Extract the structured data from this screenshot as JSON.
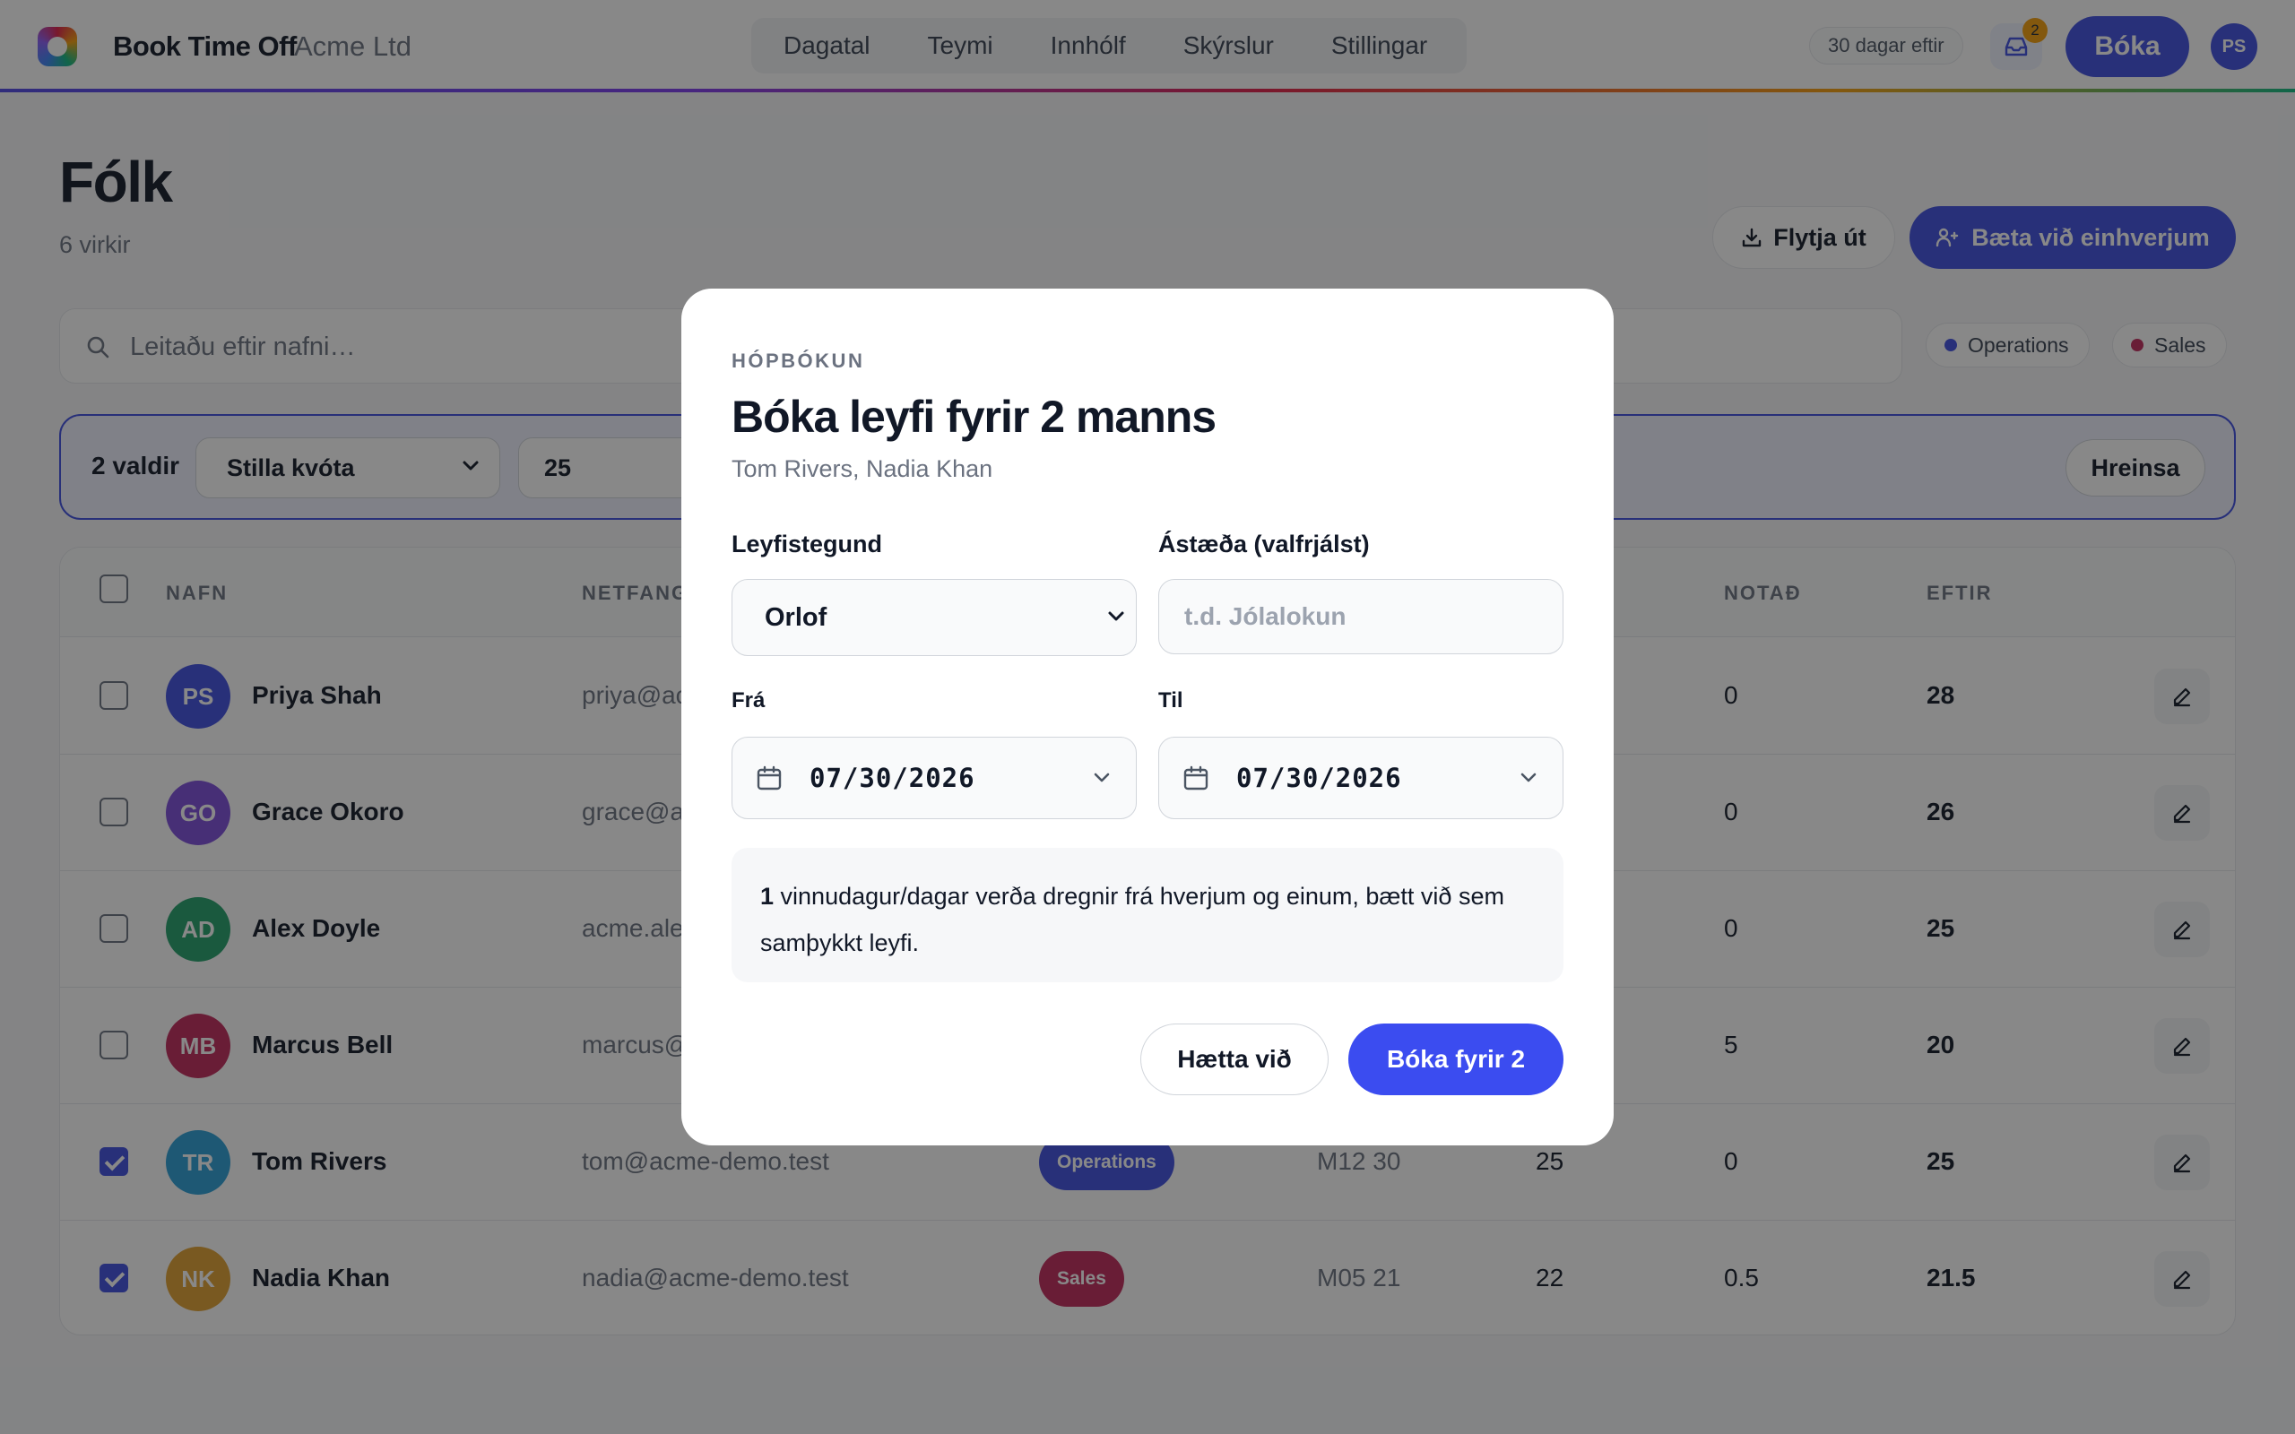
{
  "app": {
    "brand": "Book Time Off",
    "org": "Acme Ltd",
    "nav": [
      "Dagatal",
      "Teymi",
      "Innhólf",
      "Skýrslur",
      "Stillingar"
    ],
    "days_left": "30 dagar eftir",
    "inbox_count": "2",
    "book_label": "Bóka",
    "user_initials": "PS"
  },
  "page": {
    "title": "Fólk",
    "subtitle": "6 virkir",
    "export_label": "Flytja út",
    "add_label": "Bæta við einhverjum"
  },
  "search": {
    "placeholder": "Leitaðu eftir nafni…"
  },
  "filters": [
    {
      "label": "Operations",
      "color": "#3f4fe0"
    },
    {
      "label": "Sales",
      "color": "#c0285a"
    }
  ],
  "bulk": {
    "count": "2 valdir",
    "action": "Stilla kvóta",
    "value": "25",
    "clear": "Hreinsa"
  },
  "table": {
    "headers": {
      "name": "NAFN",
      "email": "NETFANG",
      "used": "NOTAÐ",
      "left": "EFTIR"
    },
    "rows": [
      {
        "initials": "PS",
        "avatar_color": "#3f4fe0",
        "name": "Priya Shah",
        "email": "priya@acme-demo.test",
        "team": "",
        "code": "",
        "quota": "",
        "used": "0",
        "left": "28",
        "checked": false
      },
      {
        "initials": "GO",
        "avatar_color": "#7c4ddb",
        "name": "Grace Okoro",
        "email": "grace@acme-demo.test",
        "team": "",
        "code": "",
        "quota": "",
        "used": "0",
        "left": "26",
        "checked": false
      },
      {
        "initials": "AD",
        "avatar_color": "#22a06b",
        "name": "Alex Doyle",
        "email": "acme.alex@acme-demo.test",
        "team": "",
        "code": "",
        "quota": "",
        "used": "0",
        "left": "25",
        "checked": false
      },
      {
        "initials": "MB",
        "avatar_color": "#c0285a",
        "name": "Marcus Bell",
        "email": "marcus@acme-demo.test",
        "team": "",
        "code": "",
        "quota": "",
        "used": "5",
        "left": "20",
        "checked": false
      },
      {
        "initials": "TR",
        "avatar_color": "#2b9fd6",
        "name": "Tom Rivers",
        "email": "tom@acme-demo.test",
        "team": "Operations",
        "team_color": "#3f4fe0",
        "code": "M12 30",
        "quota": "25",
        "used": "0",
        "left": "25",
        "checked": true
      },
      {
        "initials": "NK",
        "avatar_color": "#e0a030",
        "name": "Nadia Khan",
        "email": "nadia@acme-demo.test",
        "team": "Sales",
        "team_color": "#c0285a",
        "code": "M05 21",
        "quota": "22",
        "used": "0.5",
        "left": "21.5",
        "checked": true
      }
    ]
  },
  "modal": {
    "eyebrow": "HÓPBÓKUN",
    "title": "Bóka leyfi fyrir 2 manns",
    "names": "Tom Rivers, Nadia Khan",
    "type_label": "Leyfistegund",
    "type_value": "Orlof",
    "reason_label": "Ástæða (valfrjálst)",
    "reason_placeholder": "t.d. Jólalokun",
    "from_label": "Frá",
    "from_value": "07/30/2026",
    "to_label": "Til",
    "to_value": "07/30/2026",
    "info_count": "1",
    "info_text": " vinnudagur/dagar verða dregnir frá hverjum og einum, bætt við sem samþykkt leyfi.",
    "cancel_label": "Hætta við",
    "confirm_label": "Bóka fyrir 2"
  }
}
